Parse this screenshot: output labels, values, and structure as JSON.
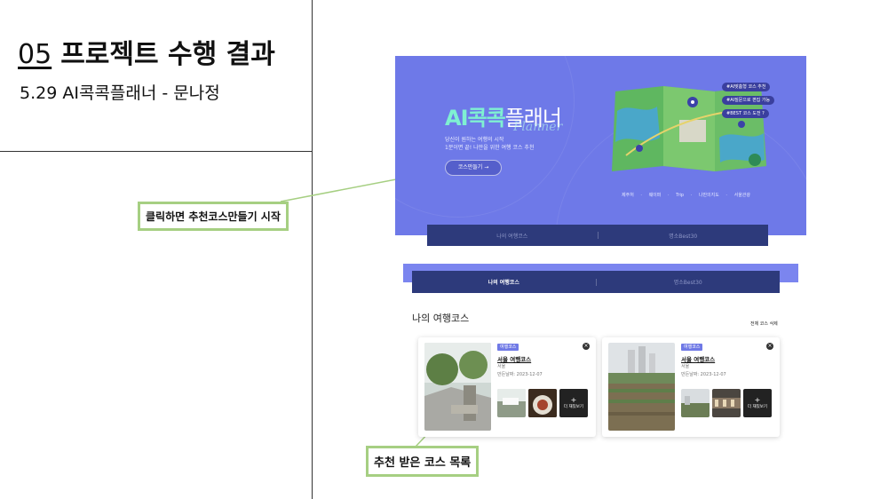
{
  "slide": {
    "number": "05",
    "title": "프로젝트 수행 결과",
    "subtitle": "5.29 AI콕콕플래너 - 문나정"
  },
  "callouts": {
    "start": "클릭하면 추천코스만들기 시작",
    "list": "추천 받은 코스 목록"
  },
  "hero": {
    "logo_prefix": "AI콕콕",
    "logo_suffix": "플래너",
    "logo_script": "Planner",
    "desc_line1": "당신이 원하는 여행의 시작",
    "desc_line2": "1분이면 끝! 나만을 위한 여행 코스 추천",
    "button_label": "코스만들기 →",
    "pills": [
      "#AI맞춤형 코스 추천",
      "#AI질문으로 편집 가능",
      "#BEST 코스 도전 ?"
    ],
    "partners": "제주처 · 웨이퍼 · Trip · 나만의지도 · 서울관광"
  },
  "top_tabs": [
    "나의 여행코스",
    "명소Best30"
  ],
  "sub_tabs": [
    "나의 여행코스",
    "명소Best30"
  ],
  "section": {
    "title": "나의 여행코스",
    "view_all": "전체 코스 삭제"
  },
  "cards": [
    {
      "badge": "여행코스",
      "title": "서울 여행코스",
      "region": "서울",
      "date": "만든날짜: 2023-12-07",
      "more_label": "더 재밌보기"
    },
    {
      "badge": "여행코스",
      "title": "서울 여행코스",
      "region": "서울",
      "date": "만든날짜: 2023-12-07",
      "more_label": "더 재밌보기"
    }
  ],
  "colors": {
    "hero_bg": "#6e79e8",
    "tab_bar": "#2d3a7b",
    "accent_mint": "#7ff0d2",
    "callout_border": "#a6cf82",
    "badge": "#6f79e6"
  }
}
